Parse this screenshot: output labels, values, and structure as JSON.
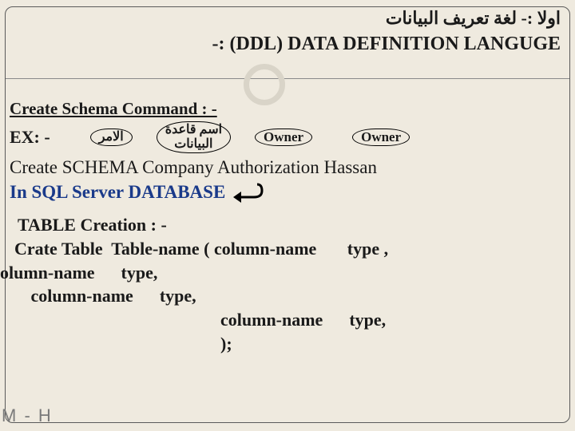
{
  "titles": {
    "arabic": "اولا :- لغة تعريف البيانات",
    "english": "-:  (DDL)  DATA DEFINITION LANGUGE"
  },
  "section1": {
    "heading": "Create  Schema Command : -",
    "ex": "EX: -",
    "cloud_command": "الامر",
    "cloud_dbname_l1": "اسم قاعدة",
    "cloud_dbname_l2": "البيانات",
    "cloud_owner1": "Owner",
    "cloud_owner2": "Owner",
    "stmt_line": "Create  SCHEMA  Company  Authorization Hassan",
    "note_line": "In SQL Server DATABASE"
  },
  "section2": {
    "heading": "TABLE Creation : -",
    "l1": "Crate Table  Table-name ( column-name       type ,",
    "l2": "olumn-name      type,",
    "l3": "   column-name      type,",
    "l4": "                                                column-name      type,",
    "l5": "                                                );"
  },
  "footer": "M - H"
}
